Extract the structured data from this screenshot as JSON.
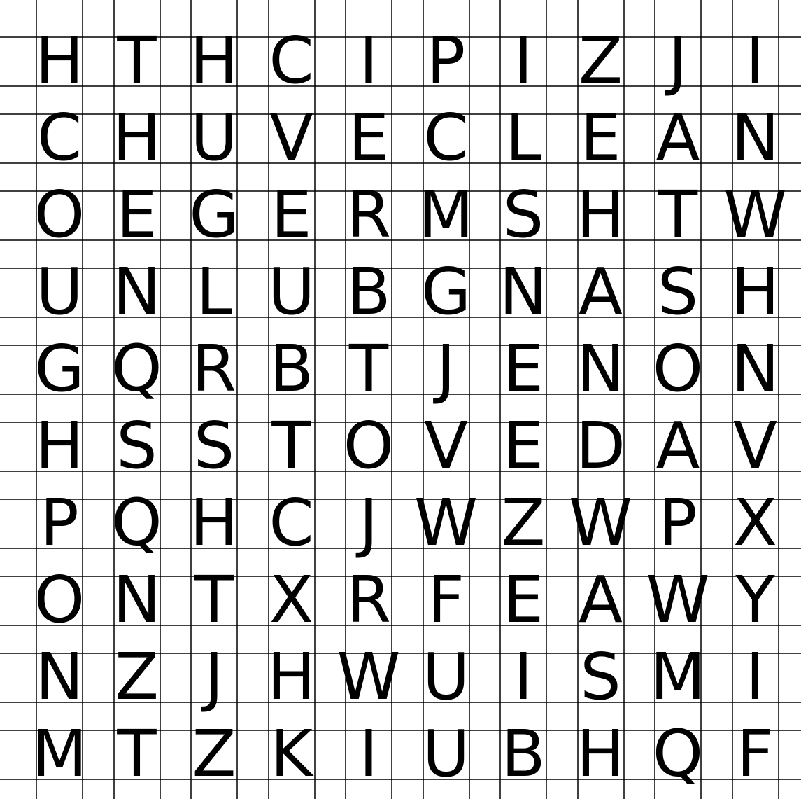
{
  "puzzle": {
    "rows": [
      [
        "H",
        "T",
        "H",
        "C",
        "I",
        "P",
        "I",
        "Z",
        "J",
        "I"
      ],
      [
        "C",
        "H",
        "U",
        "V",
        "E",
        "C",
        "L",
        "E",
        "A",
        "N"
      ],
      [
        "O",
        "E",
        "G",
        "E",
        "R",
        "M",
        "S",
        "H",
        "T",
        "W"
      ],
      [
        "U",
        "N",
        "L",
        "U",
        "B",
        "G",
        "N",
        "A",
        "S",
        "H"
      ],
      [
        "G",
        "Q",
        "R",
        "B",
        "T",
        "J",
        "E",
        "N",
        "O",
        "N"
      ],
      [
        "H",
        "S",
        "S",
        "T",
        "O",
        "V",
        "E",
        "D",
        "A",
        "V"
      ],
      [
        "P",
        "Q",
        "H",
        "C",
        "J",
        "W",
        "Z",
        "W",
        "P",
        "X"
      ],
      [
        "O",
        "N",
        "T",
        "X",
        "R",
        "F",
        "E",
        "A",
        "W",
        "Y"
      ],
      [
        "N",
        "Z",
        "J",
        "H",
        "W",
        "U",
        "I",
        "S",
        "M",
        "I"
      ],
      [
        "M",
        "T",
        "Z",
        "K",
        "I",
        "U",
        "B",
        "H",
        "Q",
        "F"
      ]
    ],
    "colors": {
      "letter": "#000000",
      "grid": "#000000",
      "background": "#ffffff"
    }
  }
}
